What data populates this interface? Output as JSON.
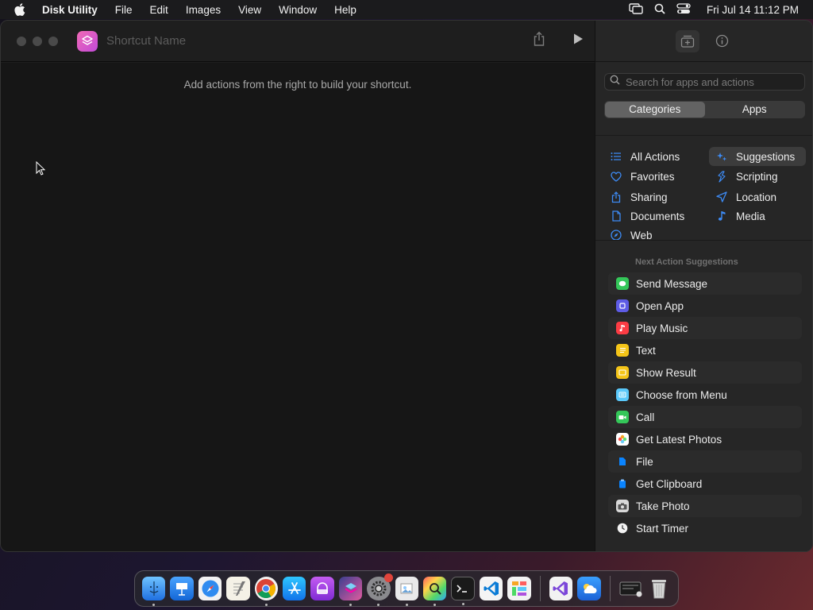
{
  "menubar": {
    "app_name": "Disk Utility",
    "menus": [
      "File",
      "Edit",
      "Images",
      "View",
      "Window",
      "Help"
    ],
    "clock": "Fri Jul 14  11:12 PM"
  },
  "window": {
    "shortcut_name_placeholder": "Shortcut Name",
    "editor_hint": "Add actions from the right to build your shortcut."
  },
  "sidebar": {
    "search_placeholder": "Search for apps and actions",
    "segments": {
      "categories": "Categories",
      "apps": "Apps"
    },
    "categories_left": [
      {
        "label": "All Actions",
        "icon": "list-icon"
      },
      {
        "label": "Favorites",
        "icon": "heart-icon"
      },
      {
        "label": "Sharing",
        "icon": "share-icon"
      },
      {
        "label": "Documents",
        "icon": "document-icon"
      },
      {
        "label": "Web",
        "icon": "compass-icon"
      }
    ],
    "categories_right": [
      {
        "label": "Suggestions",
        "icon": "sparkles-icon"
      },
      {
        "label": "Scripting",
        "icon": "scripting-icon"
      },
      {
        "label": "Location",
        "icon": "location-arrow-icon"
      },
      {
        "label": "Media",
        "icon": "music-note-icon"
      }
    ],
    "suggestions_header": "Next Action Suggestions",
    "suggestions": [
      {
        "label": "Send Message",
        "color": "#34c759"
      },
      {
        "label": "Open App",
        "color": "#5e5ce6"
      },
      {
        "label": "Play Music",
        "color": "#fc3c44"
      },
      {
        "label": "Text",
        "color": "#f5c518"
      },
      {
        "label": "Show Result",
        "color": "#f5c518"
      },
      {
        "label": "Choose from Menu",
        "color": "#5ac8fa"
      },
      {
        "label": "Call",
        "color": "#34c759"
      },
      {
        "label": "Get Latest Photos",
        "color": "#ffffff"
      },
      {
        "label": "File",
        "color": "#0a84ff"
      },
      {
        "label": "Get Clipboard",
        "color": "#0a84ff"
      },
      {
        "label": "Take Photo",
        "color": "#8e8e93"
      },
      {
        "label": "Start Timer",
        "color": "#ffffff"
      }
    ]
  },
  "dock": {
    "apps": [
      "Finder",
      "Keynote",
      "Safari",
      "TextEdit",
      "Chrome",
      "App Store",
      "Podcasts",
      "Shortcuts",
      "System Settings",
      "Preview",
      "ColorSync",
      "Terminal",
      "VS Code",
      "Mosaic"
    ],
    "apps_after_sep": [
      "Visual Studio",
      "Weather"
    ],
    "tail": [
      "Downloads",
      "Trash"
    ]
  }
}
